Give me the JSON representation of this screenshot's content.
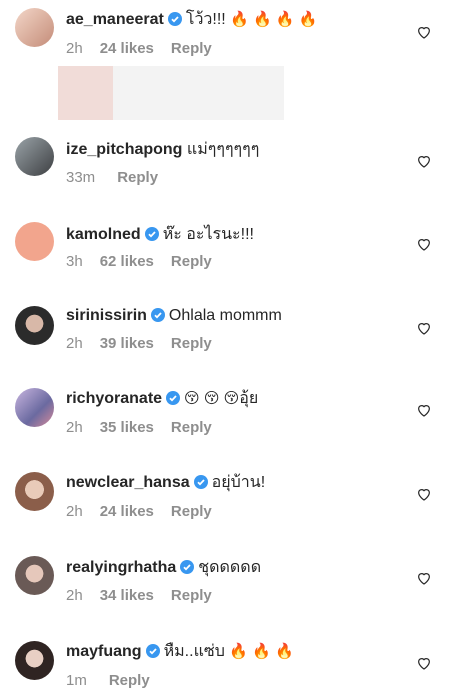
{
  "comments": [
    {
      "username": "ae_maneerat",
      "verified": true,
      "text": "โว้ว!!! ",
      "emoji": "🔥 🔥 🔥 🔥",
      "time": "2h",
      "likes": "24 likes",
      "reply": "Reply",
      "avatar_color": "#d9b0a0"
    },
    {
      "username": "ize_pitchapong",
      "verified": false,
      "text": "แม่ๆๆๆๆๆๆ",
      "emoji": "",
      "time": "33m",
      "likes": "",
      "reply": "Reply",
      "avatar_color": "#6e6a66"
    },
    {
      "username": "kamolned",
      "verified": true,
      "text": "ห๊ะ อะไรนะ!!!",
      "emoji": "",
      "time": "3h",
      "likes": "62 likes",
      "reply": "Reply",
      "avatar_color": "#f2a58d"
    },
    {
      "username": "sirinissirin",
      "verified": true,
      "text": "Ohlala mommm",
      "emoji": "",
      "time": "2h",
      "likes": "39 likes",
      "reply": "Reply",
      "avatar_color": "#3a3a3a"
    },
    {
      "username": "richyoranate",
      "verified": true,
      "text": "อุ้ย",
      "emoji": "😚 😚 😚",
      "time": "2h",
      "likes": "35 likes",
      "reply": "Reply",
      "avatar_color": "#a9a2c7"
    },
    {
      "username": "newclear_hansa",
      "verified": true,
      "text": "อยุ่บ้าน!",
      "emoji": "",
      "time": "2h",
      "likes": "24 likes",
      "reply": "Reply",
      "avatar_color": "#c7a08e"
    },
    {
      "username": "realyingrhatha",
      "verified": true,
      "text": "ชุดดดดด",
      "emoji": "",
      "time": "2h",
      "likes": "34 likes",
      "reply": "Reply",
      "avatar_color": "#9c8c88"
    },
    {
      "username": "mayfuang",
      "verified": true,
      "text": "หืม..แซ่บ ",
      "emoji": "🔥 🔥 🔥",
      "time": "1m",
      "likes": "",
      "reply": "Reply",
      "avatar_color": "#4a3a36"
    }
  ],
  "colors": {
    "verified": "#3897f0",
    "meta": "#8e8e8e",
    "text": "#262626"
  },
  "icons": {
    "like": "heart-outline-icon",
    "verified": "verified-badge-icon"
  }
}
